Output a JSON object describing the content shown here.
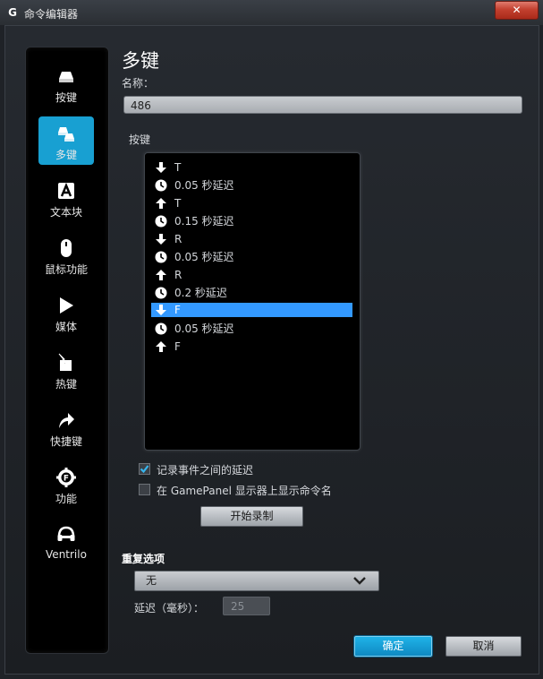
{
  "window": {
    "title": "命令编辑器",
    "close": "✕"
  },
  "sidebar": {
    "items": [
      {
        "label": "按键",
        "icon": "key-icon"
      },
      {
        "label": "多键",
        "icon": "multikey-icon",
        "active": true
      },
      {
        "label": "文本块",
        "icon": "text-block-icon"
      },
      {
        "label": "鼠标功能",
        "icon": "mouse-icon"
      },
      {
        "label": "媒体",
        "icon": "play-icon"
      },
      {
        "label": "热键",
        "icon": "hotkey-icon"
      },
      {
        "label": "快捷键",
        "icon": "shortcut-arrow-icon"
      },
      {
        "label": "功能",
        "icon": "function-gear-icon"
      },
      {
        "label": "Ventrilo",
        "icon": "headset-icon"
      }
    ]
  },
  "main": {
    "heading": "多键",
    "name_label": "名称：",
    "name_value": "486",
    "keys_label": "按键",
    "key_events": [
      {
        "type": "down",
        "text": "T"
      },
      {
        "type": "delay",
        "text": "0.05 秒延迟"
      },
      {
        "type": "up",
        "text": "T"
      },
      {
        "type": "delay",
        "text": "0.15 秒延迟"
      },
      {
        "type": "down",
        "text": "R"
      },
      {
        "type": "delay",
        "text": "0.05 秒延迟"
      },
      {
        "type": "up",
        "text": "R"
      },
      {
        "type": "delay",
        "text": "0.2 秒延迟"
      },
      {
        "type": "down",
        "text": "F",
        "selected": true
      },
      {
        "type": "delay",
        "text": "0.05 秒延迟"
      },
      {
        "type": "up",
        "text": "F"
      }
    ],
    "record_delay_label": "记录事件之间的延迟",
    "record_delay_checked": true,
    "gamepanel_label": "在 GamePanel 显示器上显示命令名",
    "gamepanel_checked": false,
    "start_record_label": "开始录制",
    "repeat_label": "重复选项",
    "repeat_value": "无",
    "delay_label": "延迟（毫秒）：",
    "delay_value": "25",
    "ok_label": "确定",
    "cancel_label": "取消"
  },
  "colors": {
    "accent": "#18a0d2",
    "selection": "#3399ff",
    "panel": "#000000"
  }
}
